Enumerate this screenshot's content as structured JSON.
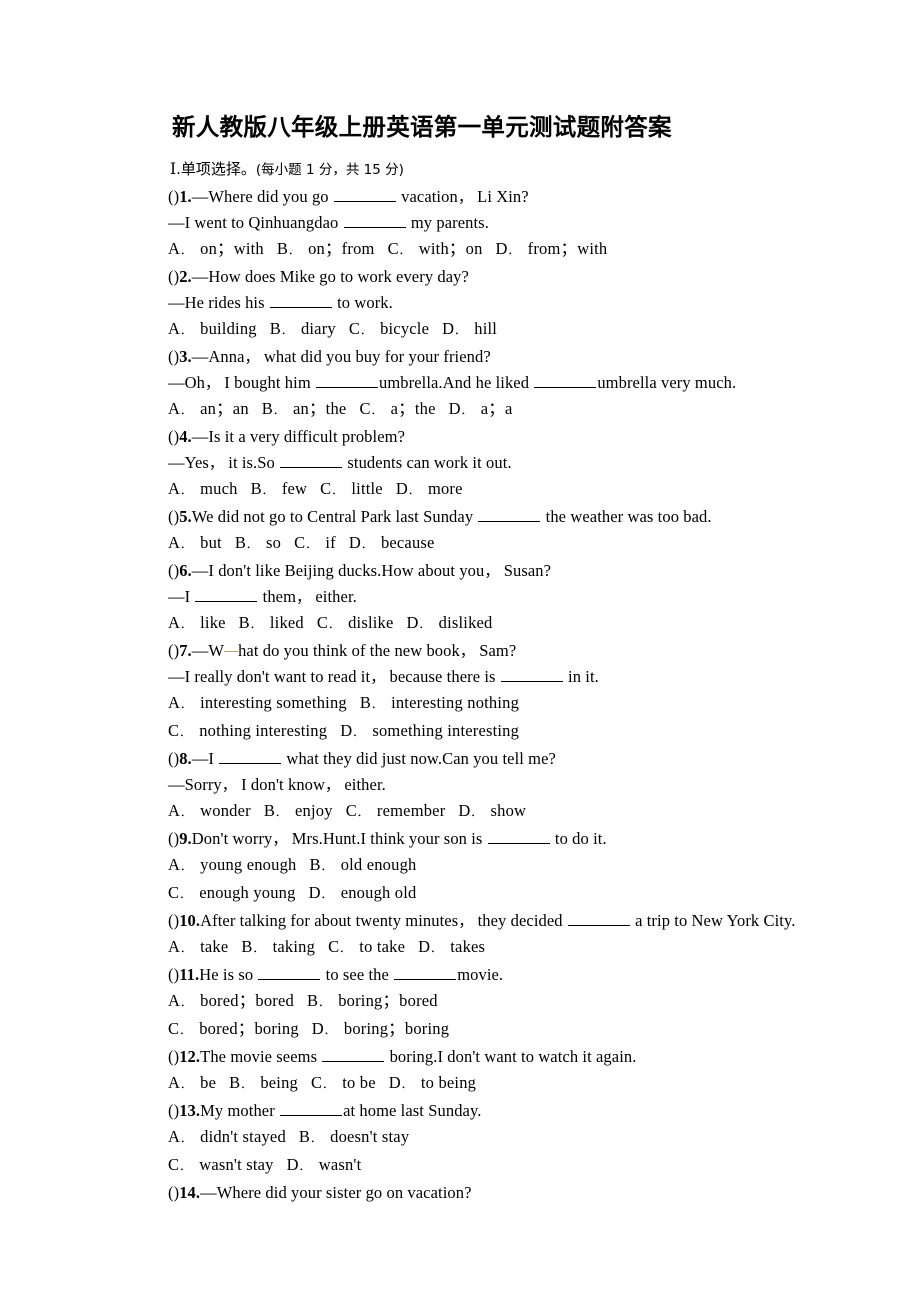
{
  "document": {
    "title": "新人教版八年级上册英语第一单元测试题附答案",
    "section": {
      "number": "Ⅰ",
      "name": ".单项选择。",
      "note": "(每小题 1 分，共 15 分)"
    }
  },
  "questions": [
    {
      "number": "1.",
      "marker": "()",
      "lines": [
        {
          "type": "stem",
          "segments": [
            {
              "t": "text",
              "v": "—Where did you go "
            },
            {
              "t": "blank"
            },
            {
              "t": "text",
              "v": " vacation"
            },
            {
              "t": "comma"
            },
            {
              "t": "text",
              "v": " Li Xin?"
            }
          ]
        },
        {
          "type": "cont",
          "segments": [
            {
              "t": "text",
              "v": "—I went to Qinhuangdao "
            },
            {
              "t": "blank"
            },
            {
              "t": "text",
              "v": " my parents."
            }
          ]
        }
      ],
      "options": [
        {
          "label": "A",
          "text": "on；with"
        },
        {
          "label": "B",
          "text": "on；from"
        },
        {
          "label": "C",
          "text": "with；on"
        },
        {
          "label": "D",
          "text": "from；with"
        }
      ]
    },
    {
      "number": "2.",
      "marker": "()",
      "lines": [
        {
          "type": "stem",
          "segments": [
            {
              "t": "text",
              "v": "—How does Mike go to work every day?"
            }
          ]
        },
        {
          "type": "cont",
          "segments": [
            {
              "t": "text",
              "v": "—He rides his "
            },
            {
              "t": "blank"
            },
            {
              "t": "text",
              "v": " to work."
            }
          ]
        }
      ],
      "options": [
        {
          "label": "A",
          "text": "building"
        },
        {
          "label": "B",
          "text": "diary"
        },
        {
          "label": "C",
          "text": "bicycle"
        },
        {
          "label": "D",
          "text": "hill"
        }
      ]
    },
    {
      "number": "3.",
      "marker": "()",
      "lines": [
        {
          "type": "stem",
          "segments": [
            {
              "t": "text",
              "v": "—Anna"
            },
            {
              "t": "comma"
            },
            {
              "t": "text",
              "v": " what did you buy for your friend?"
            }
          ]
        },
        {
          "type": "cont",
          "segments": [
            {
              "t": "text",
              "v": "—Oh"
            },
            {
              "t": "comma"
            },
            {
              "t": "text",
              "v": " I bought him "
            },
            {
              "t": "blank"
            },
            {
              "t": "text",
              "v": "umbrella.And he liked "
            },
            {
              "t": "blank"
            },
            {
              "t": "text",
              "v": "umbrella very much."
            }
          ]
        }
      ],
      "options": [
        {
          "label": "A",
          "text": "an；an"
        },
        {
          "label": "B",
          "text": "an；the"
        },
        {
          "label": "C",
          "text": "a；the"
        },
        {
          "label": "D",
          "text": "a；a"
        }
      ]
    },
    {
      "number": "4.",
      "marker": "()",
      "lines": [
        {
          "type": "stem",
          "segments": [
            {
              "t": "text",
              "v": "—Is it a very difficult problem?"
            }
          ]
        },
        {
          "type": "cont",
          "segments": [
            {
              "t": "text",
              "v": "—Yes"
            },
            {
              "t": "comma"
            },
            {
              "t": "text",
              "v": " it is.So "
            },
            {
              "t": "blank"
            },
            {
              "t": "text",
              "v": " students can work it out."
            }
          ]
        }
      ],
      "options": [
        {
          "label": "A",
          "text": "much"
        },
        {
          "label": "B",
          "text": "few"
        },
        {
          "label": "C",
          "text": "little"
        },
        {
          "label": "D",
          "text": "more"
        }
      ]
    },
    {
      "number": "5.",
      "marker": "()",
      "lines": [
        {
          "type": "stem",
          "segments": [
            {
              "t": "text",
              "v": "We did not go to Central Park last Sunday "
            },
            {
              "t": "blank"
            },
            {
              "t": "text",
              "v": " the weather was too bad."
            }
          ]
        }
      ],
      "options": [
        {
          "label": "A",
          "text": "but"
        },
        {
          "label": "B",
          "text": "so"
        },
        {
          "label": "C",
          "text": "if"
        },
        {
          "label": "D",
          "text": "because"
        }
      ]
    },
    {
      "number": "6.",
      "marker": "()",
      "lines": [
        {
          "type": "stem",
          "segments": [
            {
              "t": "text",
              "v": "—I don't like Beijing ducks.How about you"
            },
            {
              "t": "comma"
            },
            {
              "t": "text",
              "v": " Susan?"
            }
          ]
        },
        {
          "type": "cont",
          "segments": [
            {
              "t": "text",
              "v": "—I "
            },
            {
              "t": "blank"
            },
            {
              "t": "text",
              "v": " them"
            },
            {
              "t": "comma"
            },
            {
              "t": "text",
              "v": " either."
            }
          ]
        }
      ],
      "options": [
        {
          "label": "A",
          "text": "like"
        },
        {
          "label": "B",
          "text": "liked"
        },
        {
          "label": "C",
          "text": "dislike"
        },
        {
          "label": "D",
          "text": "disliked"
        }
      ]
    },
    {
      "number": "7.",
      "marker": "()",
      "lines": [
        {
          "type": "stem",
          "segments": [
            {
              "t": "text",
              "v": "—W"
            },
            {
              "t": "strike"
            },
            {
              "t": "text",
              "v": "hat do you think of the new book"
            },
            {
              "t": "comma"
            },
            {
              "t": "text",
              "v": " Sam?"
            }
          ]
        },
        {
          "type": "cont",
          "segments": [
            {
              "t": "text",
              "v": "—I really don't want to read it"
            },
            {
              "t": "comma"
            },
            {
              "t": "text",
              "v": " because there is "
            },
            {
              "t": "blank"
            },
            {
              "t": "text",
              "v": " in it."
            }
          ]
        }
      ],
      "options": [
        {
          "label": "A",
          "text": "interesting something"
        },
        {
          "label": "B",
          "text": "interesting nothing"
        },
        {
          "label": "C",
          "text": "nothing interesting"
        },
        {
          "label": "D",
          "text": "something interesting"
        }
      ],
      "options_two_rows": true
    },
    {
      "number": "8.",
      "marker": "()",
      "lines": [
        {
          "type": "stem",
          "segments": [
            {
              "t": "text",
              "v": "—I "
            },
            {
              "t": "blank"
            },
            {
              "t": "text",
              "v": " what they did just now.Can you tell me?"
            }
          ]
        },
        {
          "type": "cont",
          "segments": [
            {
              "t": "text",
              "v": "—Sorry"
            },
            {
              "t": "comma"
            },
            {
              "t": "text",
              "v": " I don't know"
            },
            {
              "t": "comma"
            },
            {
              "t": "text",
              "v": " either."
            }
          ]
        }
      ],
      "options": [
        {
          "label": "A",
          "text": "wonder"
        },
        {
          "label": "B",
          "text": "enjoy"
        },
        {
          "label": "C",
          "text": "remember"
        },
        {
          "label": "D",
          "text": "show"
        }
      ]
    },
    {
      "number": "9.",
      "marker": "()",
      "lines": [
        {
          "type": "stem",
          "segments": [
            {
              "t": "text",
              "v": "Don't worry"
            },
            {
              "t": "comma"
            },
            {
              "t": "text",
              "v": " Mrs.Hunt.I think your son is "
            },
            {
              "t": "blank"
            },
            {
              "t": "text",
              "v": " to do it."
            }
          ]
        }
      ],
      "options": [
        {
          "label": "A",
          "text": "young enough"
        },
        {
          "label": "B",
          "text": "old enough"
        },
        {
          "label": "C",
          "text": "enough young"
        },
        {
          "label": "D",
          "text": "enough old"
        }
      ],
      "options_two_rows": true
    },
    {
      "number": "10.",
      "marker": "()",
      "lines": [
        {
          "type": "stem",
          "segments": [
            {
              "t": "text",
              "v": "After talking for about twenty minutes"
            },
            {
              "t": "comma"
            },
            {
              "t": "text",
              "v": " they decided "
            },
            {
              "t": "blank"
            },
            {
              "t": "text",
              "v": " a trip to New York City."
            }
          ]
        }
      ],
      "options": [
        {
          "label": "A",
          "text": "take"
        },
        {
          "label": "B",
          "text": "taking"
        },
        {
          "label": "C",
          "text": "to take"
        },
        {
          "label": "D",
          "text": "takes"
        }
      ]
    },
    {
      "number": "11.",
      "marker": "()",
      "lines": [
        {
          "type": "stem",
          "segments": [
            {
              "t": "text",
              "v": "He is so "
            },
            {
              "t": "blank"
            },
            {
              "t": "text",
              "v": " to see the "
            },
            {
              "t": "blank"
            },
            {
              "t": "text",
              "v": "movie."
            }
          ]
        }
      ],
      "options": [
        {
          "label": "A",
          "text": "bored；bored"
        },
        {
          "label": "B",
          "text": "boring；bored"
        },
        {
          "label": "C",
          "text": "bored；boring"
        },
        {
          "label": "D",
          "text": "boring；boring"
        }
      ],
      "options_two_rows": true
    },
    {
      "number": "12.",
      "marker": "()",
      "lines": [
        {
          "type": "stem",
          "segments": [
            {
              "t": "text",
              "v": "The movie seems "
            },
            {
              "t": "blank"
            },
            {
              "t": "text",
              "v": " boring.I don't want to watch it again."
            }
          ]
        }
      ],
      "options": [
        {
          "label": "A",
          "text": "be"
        },
        {
          "label": "B",
          "text": "being"
        },
        {
          "label": "C",
          "text": "to be"
        },
        {
          "label": "D",
          "text": "to being"
        }
      ]
    },
    {
      "number": "13.",
      "marker": "()",
      "lines": [
        {
          "type": "stem",
          "segments": [
            {
              "t": "text",
              "v": "My mother "
            },
            {
              "t": "blank"
            },
            {
              "t": "text",
              "v": "at home last Sunday."
            }
          ]
        }
      ],
      "options": [
        {
          "label": "A",
          "text": "didn't stayed"
        },
        {
          "label": "B",
          "text": "doesn't stay"
        },
        {
          "label": "C",
          "text": "wasn't stay"
        },
        {
          "label": "D",
          "text": "wasn't"
        }
      ],
      "options_two_rows": true
    },
    {
      "number": "14.",
      "marker": "()",
      "lines": [
        {
          "type": "stem",
          "segments": [
            {
              "t": "text",
              "v": "—Where did your sister go on vacation?"
            }
          ]
        }
      ],
      "options": []
    }
  ]
}
